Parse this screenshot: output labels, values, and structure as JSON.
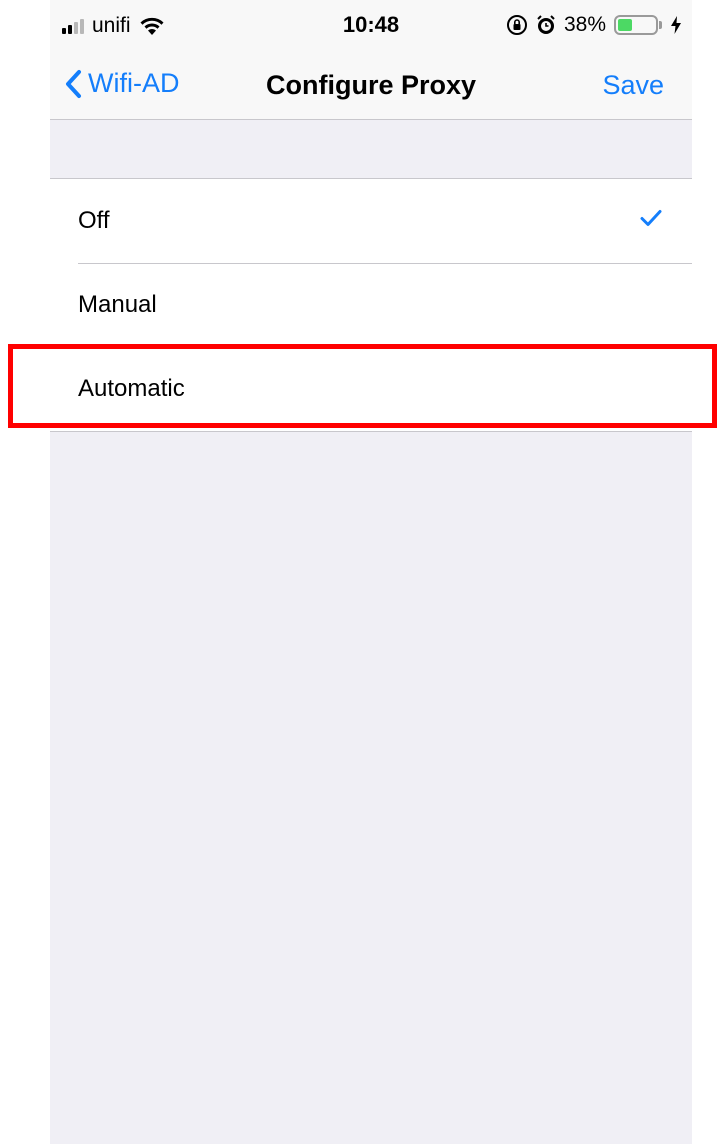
{
  "status_bar": {
    "carrier": "unifi",
    "time": "10:48",
    "battery_percent": "38%",
    "battery_level": 0.38,
    "icons": [
      "signal-icon",
      "wifi-icon",
      "rotation-lock-icon",
      "alarm-icon",
      "battery-icon",
      "charging-bolt-icon"
    ]
  },
  "nav": {
    "back_label": "Wifi-AD",
    "title": "Configure Proxy",
    "save_label": "Save"
  },
  "options": [
    {
      "label": "Off",
      "selected": true
    },
    {
      "label": "Manual",
      "selected": false
    },
    {
      "label": "Automatic",
      "selected": false
    }
  ],
  "colors": {
    "accent": "#147efb",
    "highlight": "#ff0000",
    "background": "#f0eff5"
  }
}
